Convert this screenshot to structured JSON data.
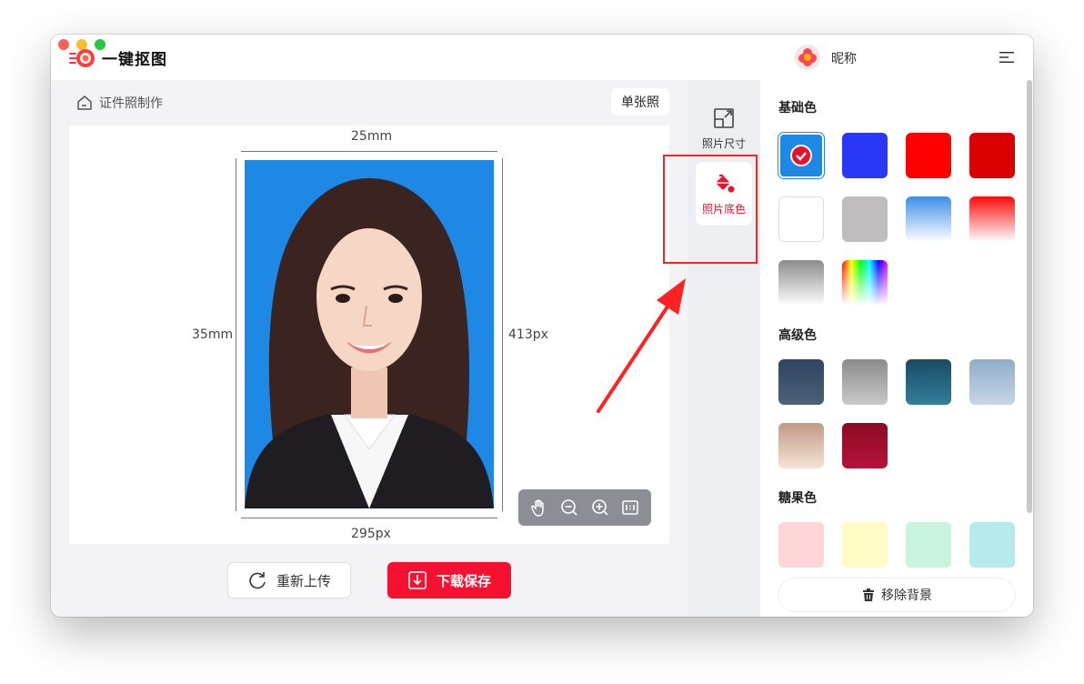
{
  "window": {
    "title": "一键抠图",
    "username": "昵称"
  },
  "breadcrumb": {
    "label": "证件照制作"
  },
  "mode": {
    "single_label": "单张照"
  },
  "canvas": {
    "width_mm": "25mm",
    "height_mm": "35mm",
    "width_px": "295px",
    "height_px": "413px",
    "photo_bg": "#1e88e5"
  },
  "zoom_tools": {
    "icons": [
      "hand-icon",
      "zoom-out-icon",
      "zoom-in-icon",
      "actual-size-icon"
    ]
  },
  "actions": {
    "reupload_label": "重新上传",
    "save_label": "下载保存"
  },
  "tabs": [
    {
      "label": "照片尺寸",
      "icon": "resize-icon",
      "active": false
    },
    {
      "label": "照片底色",
      "icon": "paint-bucket-icon",
      "active": true
    }
  ],
  "colors": {
    "basic_title": "基础色",
    "basic": [
      {
        "fill": "#1e88e5",
        "selected": true
      },
      {
        "fill": "#2b37f6"
      },
      {
        "fill": "#ff0000"
      },
      {
        "fill": "#d80000"
      },
      {
        "fill": "#ffffff"
      },
      {
        "fill": "#bfbdbd"
      },
      {
        "fill": "linear-gradient(#3d8fe8, #ffffff)"
      },
      {
        "fill": "linear-gradient(#ff0a0a, #ffffff)"
      },
      {
        "fill": "linear-gradient(#8c8c8c, #ffffff)"
      },
      {
        "fill": "linear-gradient(to bottom, rgba(255,255,255,0), #ffffff), linear-gradient(to right, #ff0000, #ffff00, #00ff00, #00ffff, #0000ff, #ff00ff)"
      }
    ],
    "advanced_title": "高级色",
    "advanced": [
      {
        "fill": "linear-gradient(#2e4460, #4d6178)"
      },
      {
        "fill": "linear-gradient(#8a8a8a, #c9c9c9)"
      },
      {
        "fill": "linear-gradient(#174c63, #347d99)"
      },
      {
        "fill": "linear-gradient(#8fadc8, #c7d6e6)"
      },
      {
        "fill": "linear-gradient(#c19a82, #f6e3d6)"
      },
      {
        "fill": "linear-gradient(#8e0a25, #b5123a)"
      }
    ],
    "candy_title": "糖果色",
    "candy": [
      {
        "fill": "#ffd6d8"
      },
      {
        "fill": "#fffbc4"
      },
      {
        "fill": "#c9f4de"
      },
      {
        "fill": "#b7eaea"
      }
    ]
  },
  "remove_bg_label": "移除背景"
}
